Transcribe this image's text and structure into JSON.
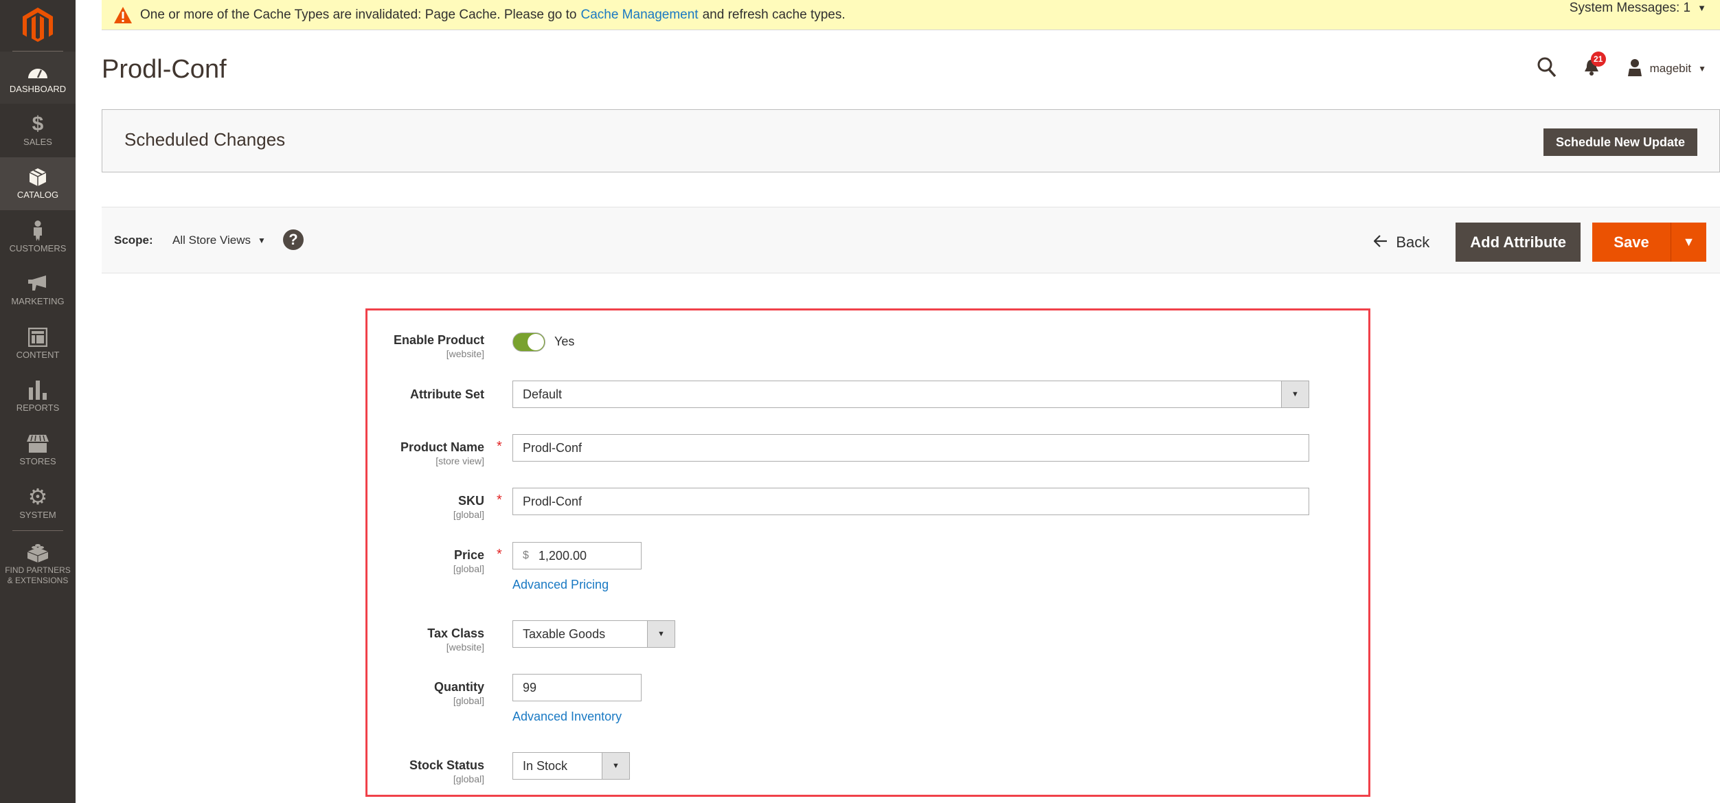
{
  "sidebar": {
    "items": [
      {
        "label": "DASHBOARD",
        "icon": "dashboard-icon"
      },
      {
        "label": "SALES",
        "icon": "dollar-icon"
      },
      {
        "label": "CATALOG",
        "icon": "box-icon"
      },
      {
        "label": "CUSTOMERS",
        "icon": "person-icon"
      },
      {
        "label": "MARKETING",
        "icon": "megaphone-icon"
      },
      {
        "label": "CONTENT",
        "icon": "layout-icon"
      },
      {
        "label": "REPORTS",
        "icon": "bar-chart-icon"
      },
      {
        "label": "STORES",
        "icon": "store-icon"
      },
      {
        "label": "SYSTEM",
        "icon": "gear-icon"
      },
      {
        "label": "FIND PARTNERS & EXTENSIONS",
        "icon": "lego-brick-icon"
      }
    ],
    "active": "CATALOG"
  },
  "notice": {
    "text_before": "One or more of the Cache Types are invalidated: Page Cache. Please go to",
    "link": "Cache Management",
    "text_after": "and refresh cache types.",
    "system_messages": "System Messages: 1"
  },
  "header": {
    "title": "Prodl-Conf",
    "notification_count": "21",
    "username": "magebit"
  },
  "scheduled": {
    "title": "Scheduled Changes",
    "button": "Schedule New Update"
  },
  "scope_bar": {
    "label": "Scope:",
    "value": "All Store Views",
    "help": "?",
    "back": "Back",
    "add_attribute": "Add Attribute",
    "save": "Save"
  },
  "form": {
    "enable_product": {
      "label": "Enable Product",
      "scope": "[website]",
      "value": "Yes",
      "enabled": true
    },
    "attribute_set": {
      "label": "Attribute Set",
      "value": "Default"
    },
    "product_name": {
      "label": "Product Name",
      "scope": "[store view]",
      "value": "Prodl-Conf",
      "required": "*"
    },
    "sku": {
      "label": "SKU",
      "scope": "[global]",
      "value": "Prodl-Conf",
      "required": "*"
    },
    "price": {
      "label": "Price",
      "scope": "[global]",
      "currency": "$",
      "value": "1,200.00",
      "required": "*",
      "link": "Advanced Pricing"
    },
    "tax_class": {
      "label": "Tax Class",
      "scope": "[website]",
      "value": "Taxable Goods"
    },
    "quantity": {
      "label": "Quantity",
      "scope": "[global]",
      "value": "99",
      "link": "Advanced Inventory"
    },
    "stock_status": {
      "label": "Stock Status",
      "scope": "[global]",
      "value": "In Stock"
    }
  },
  "colors": {
    "accent": "#eb5202",
    "dark_button": "#514943",
    "link": "#1979c3",
    "highlight_border": "#f0414a",
    "toggle_on": "#79a22e"
  }
}
